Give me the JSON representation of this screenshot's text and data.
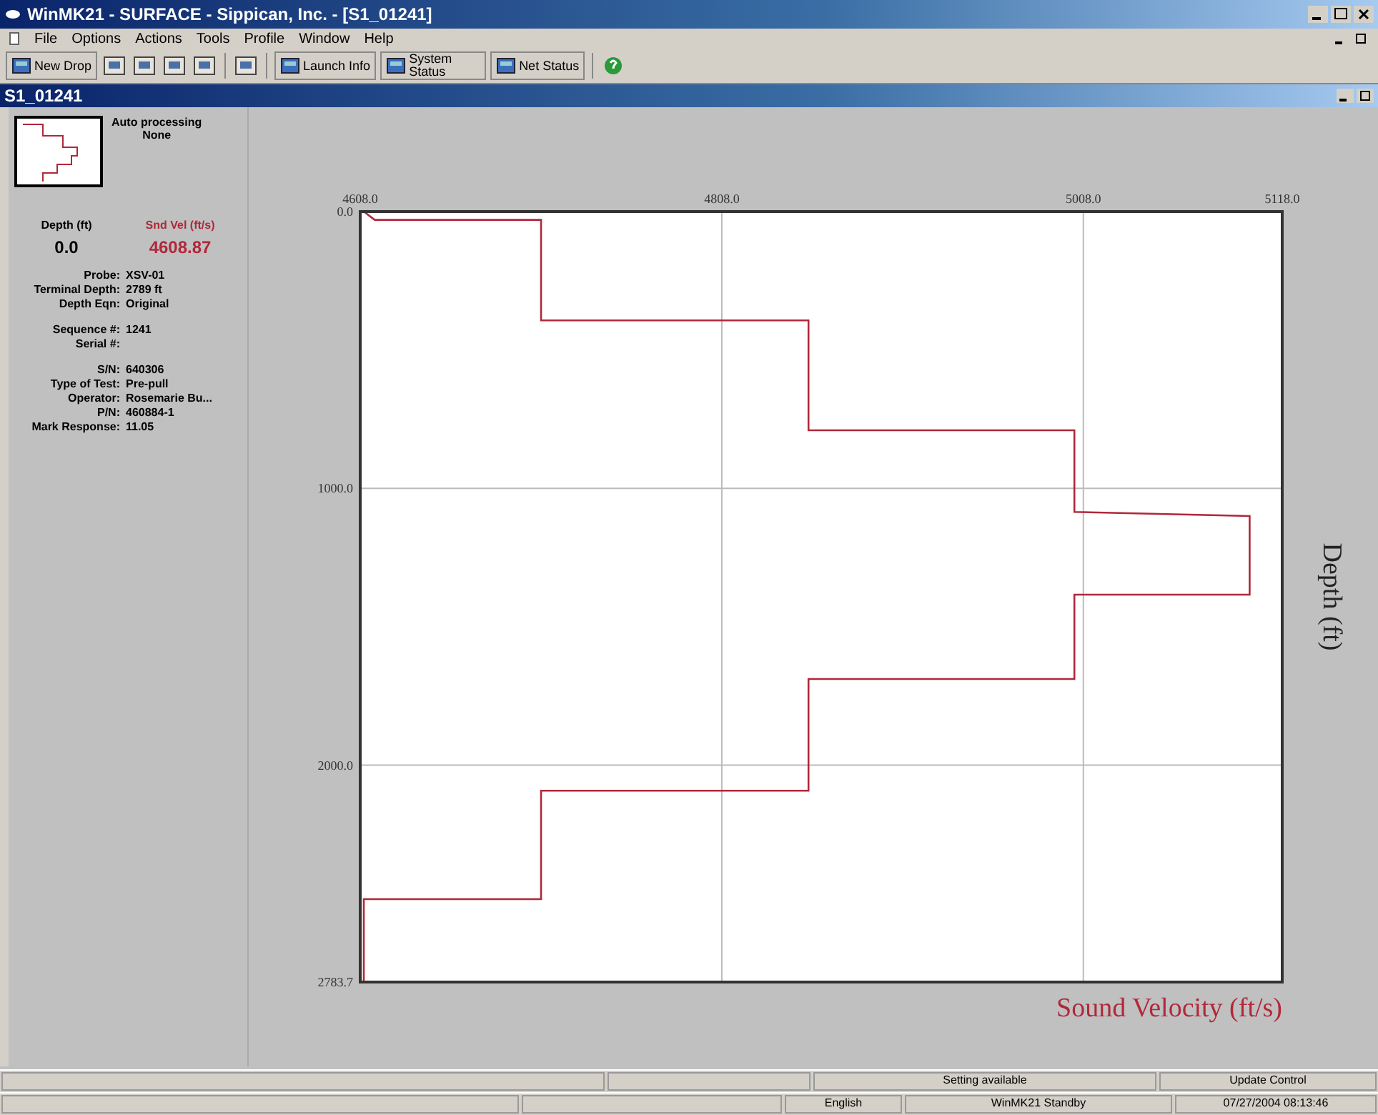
{
  "window": {
    "title": "WinMK21 - SURFACE - Sippican, Inc. - [S1_01241]"
  },
  "menu": [
    "File",
    "Options",
    "Actions",
    "Tools",
    "Profile",
    "Window",
    "Help"
  ],
  "toolbar": [
    {
      "kind": "text",
      "label": "New Drop"
    },
    {
      "kind": "icon"
    },
    {
      "kind": "icon"
    },
    {
      "kind": "icon"
    },
    {
      "kind": "icon"
    },
    {
      "kind": "sep"
    },
    {
      "kind": "icon"
    },
    {
      "kind": "sep"
    },
    {
      "kind": "text",
      "label": "Launch Info"
    },
    {
      "kind": "text",
      "label": "System Status"
    },
    {
      "kind": "text",
      "label": "Net Status"
    },
    {
      "kind": "sep"
    },
    {
      "kind": "help"
    }
  ],
  "child": {
    "title": "S1_01241"
  },
  "panel": {
    "processing_label": "Auto processing",
    "processing_value": "None",
    "depth_label": "Depth (ft)",
    "depth_value": "0.0",
    "velocity_label": "Snd Vel (ft/s)",
    "velocity_value": "4608.87",
    "groups": [
      [
        {
          "label": "Probe:",
          "value": "XSV-01"
        },
        {
          "label": "Terminal Depth:",
          "value": "2789 ft"
        },
        {
          "label": "Depth Eqn:",
          "value": "Original"
        }
      ],
      [
        {
          "label": "Sequence #:",
          "value": "1241"
        },
        {
          "label": "Serial #:"
        }
      ],
      [
        {
          "label": "S/N:",
          "value": "640306"
        },
        {
          "label": "Type of Test:",
          "value": "Pre-pull"
        },
        {
          "label": "Operator:",
          "value": "Rosemarie Bu..."
        },
        {
          "label": "P/N:",
          "value": "460884-1"
        },
        {
          "label": "Mark Response:",
          "value": "11.05"
        }
      ]
    ]
  },
  "chart": {
    "chart_data": {
      "type": "line",
      "grid": true,
      "xlabel": "Sound Velocity (ft/s)",
      "ylabel": "Depth (ft)",
      "xlim": [
        4608.0,
        5118.0
      ],
      "ylim": [
        2783.7,
        0.0
      ],
      "xticks": [
        {
          "value": 4608.0,
          "label": "4608.0"
        },
        {
          "value": 4808.0,
          "label": "4808.0"
        },
        {
          "value": 5008.0,
          "label": "5008.0"
        },
        {
          "value": 5118.0,
          "label": "5118.0"
        }
      ],
      "yticks": [
        {
          "value": 0,
          "label": "0.0"
        },
        {
          "value": 1000,
          "label": "1000.0"
        },
        {
          "value": 2000,
          "label": "2000.0"
        },
        {
          "value": 2783.7,
          "label": "2783.7"
        }
      ],
      "x": [
        4610,
        4616,
        4708,
        4708,
        4856,
        4856,
        5003,
        5003,
        5100,
        5100,
        5003,
        5003,
        4856,
        4856,
        4708,
        4708,
        4610,
        4610
      ],
      "series": [
        {
          "color": "#b0283a",
          "values": [
            0,
            30,
            30,
            393,
            393,
            790,
            790,
            1085,
            1100,
            1384,
            1384,
            1689,
            1689,
            2092,
            2092,
            2484,
            2484,
            2780
          ]
        }
      ]
    }
  },
  "status": {
    "row1": [
      "Setting available",
      "Update Control"
    ],
    "row2": [
      "English",
      "WinMK21 Standby",
      "07/27/2004 08:13:46"
    ]
  }
}
